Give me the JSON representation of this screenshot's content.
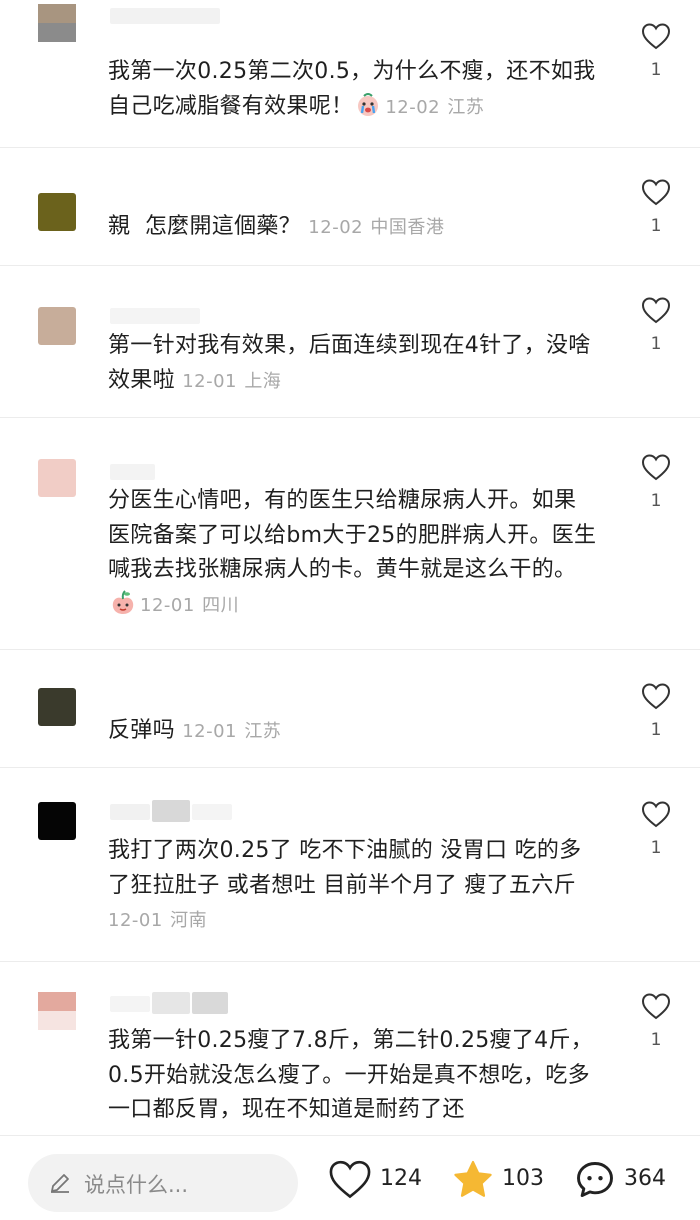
{
  "comments": [
    {
      "text": "我第一次0.25第二次0.5，为什么不瘦，还不如我自己吃减脂餐有效果呢！",
      "emoji": "crying-face",
      "date": "12-02",
      "location": "江苏",
      "likes": "1",
      "avatar_colors": [
        "#a89580",
        "#8b8b8b"
      ]
    },
    {
      "text": "親  怎麼開這個藥？",
      "date": "12-02",
      "location": "中国香港",
      "likes": "1",
      "avatar_colors": [
        "#6b621c",
        "#6b621c"
      ]
    },
    {
      "text": "第一针对我有效果，后面连续到现在4针了，没啥效果啦",
      "date": "12-01",
      "location": "上海",
      "likes": "1",
      "avatar_colors": [
        "#c7ad9a",
        "#c7ad9a"
      ]
    },
    {
      "text": "分医生心情吧，有的医生只给糖尿病人开。如果医院备案了可以给bm大于25的肥胖病人开。医生喊我去找张糖尿病人的卡。黄牛就是这么干的。",
      "emoji": "peach-face",
      "date": "12-01",
      "location": "四川",
      "likes": "1",
      "avatar_colors": [
        "#f1cdc6",
        "#f1cdc6"
      ]
    },
    {
      "text": "反弹吗",
      "date": "12-01",
      "location": "江苏",
      "likes": "1",
      "avatar_colors": [
        "#3a3a2c",
        "#3a3a2c"
      ]
    },
    {
      "text": "我打了两次0.25了 吃不下油腻的 没胃口 吃的多了狂拉肚子 或者想吐 目前半个月了 瘦了五六斤",
      "date": "12-01",
      "location": "河南",
      "likes": "1",
      "avatar_colors": [
        "#050505",
        "#050505"
      ]
    },
    {
      "text": "我第一针0.25瘦了7.8斤，第二针0.25瘦了4斤，0.5开始就没怎么瘦了。一开始是真不想吃，吃多一口都反胃，现在不知道是耐药了还",
      "likes": "1",
      "avatar_colors": [
        "#e3a99e",
        "#f6e4e1"
      ]
    }
  ],
  "bottom_bar": {
    "input_placeholder": "说点什么...",
    "likes": "124",
    "favorites": "103",
    "comments": "364",
    "colors": {
      "star": "#f5b833",
      "icon": "#222222"
    }
  }
}
